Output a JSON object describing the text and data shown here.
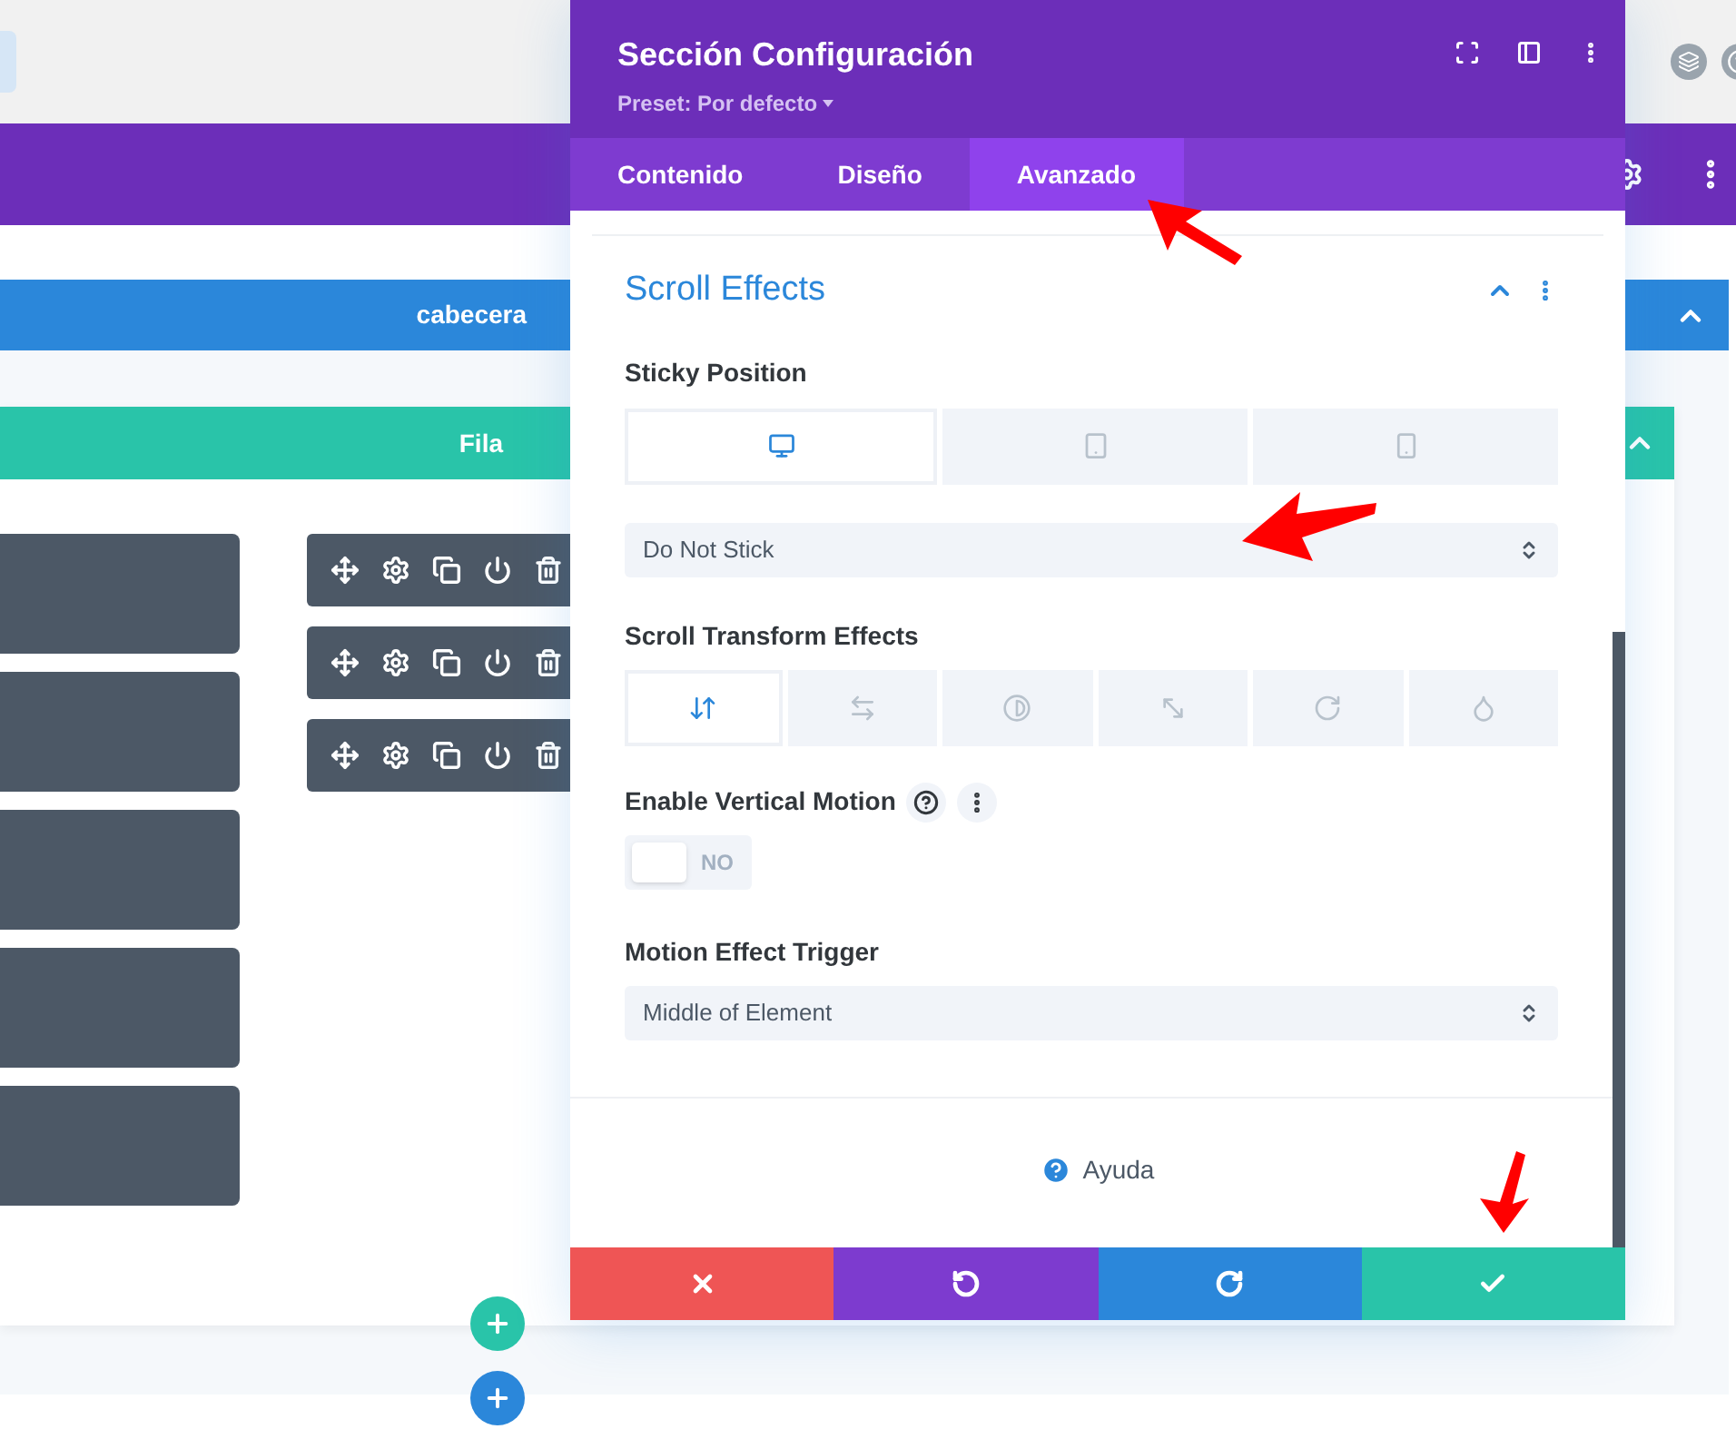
{
  "section": {
    "label": "cabecera"
  },
  "row": {
    "label": "Fila"
  },
  "modal": {
    "title": "Sección Configuración",
    "preset": "Preset: Por defecto",
    "tabs": [
      {
        "label": "Contenido",
        "selected": false
      },
      {
        "label": "Diseño",
        "selected": false
      },
      {
        "label": "Avanzado",
        "selected": true
      }
    ],
    "group": {
      "title": "Scroll Effects",
      "expanded": true
    },
    "sticky_position": {
      "label": "Sticky Position",
      "devices": [
        {
          "kind": "desktop",
          "selected": true
        },
        {
          "kind": "tablet",
          "selected": false
        },
        {
          "kind": "phone",
          "selected": false
        }
      ],
      "value": "Do Not Stick"
    },
    "scroll_transform": {
      "label": "Scroll Transform Effects",
      "effects": [
        {
          "kind": "vertical",
          "selected": true
        },
        {
          "kind": "horizontal",
          "selected": false
        },
        {
          "kind": "fade",
          "selected": false
        },
        {
          "kind": "scale",
          "selected": false
        },
        {
          "kind": "rotate",
          "selected": false
        },
        {
          "kind": "blur",
          "selected": false
        }
      ]
    },
    "vertical_motion": {
      "label": "Enable Vertical Motion",
      "on": false,
      "state_text": "NO"
    },
    "trigger": {
      "label": "Motion Effect Trigger",
      "value": "Middle of Element"
    },
    "help": "Ayuda",
    "actions": [
      {
        "kind": "discard"
      },
      {
        "kind": "undo"
      },
      {
        "kind": "redo"
      },
      {
        "kind": "save"
      }
    ]
  }
}
